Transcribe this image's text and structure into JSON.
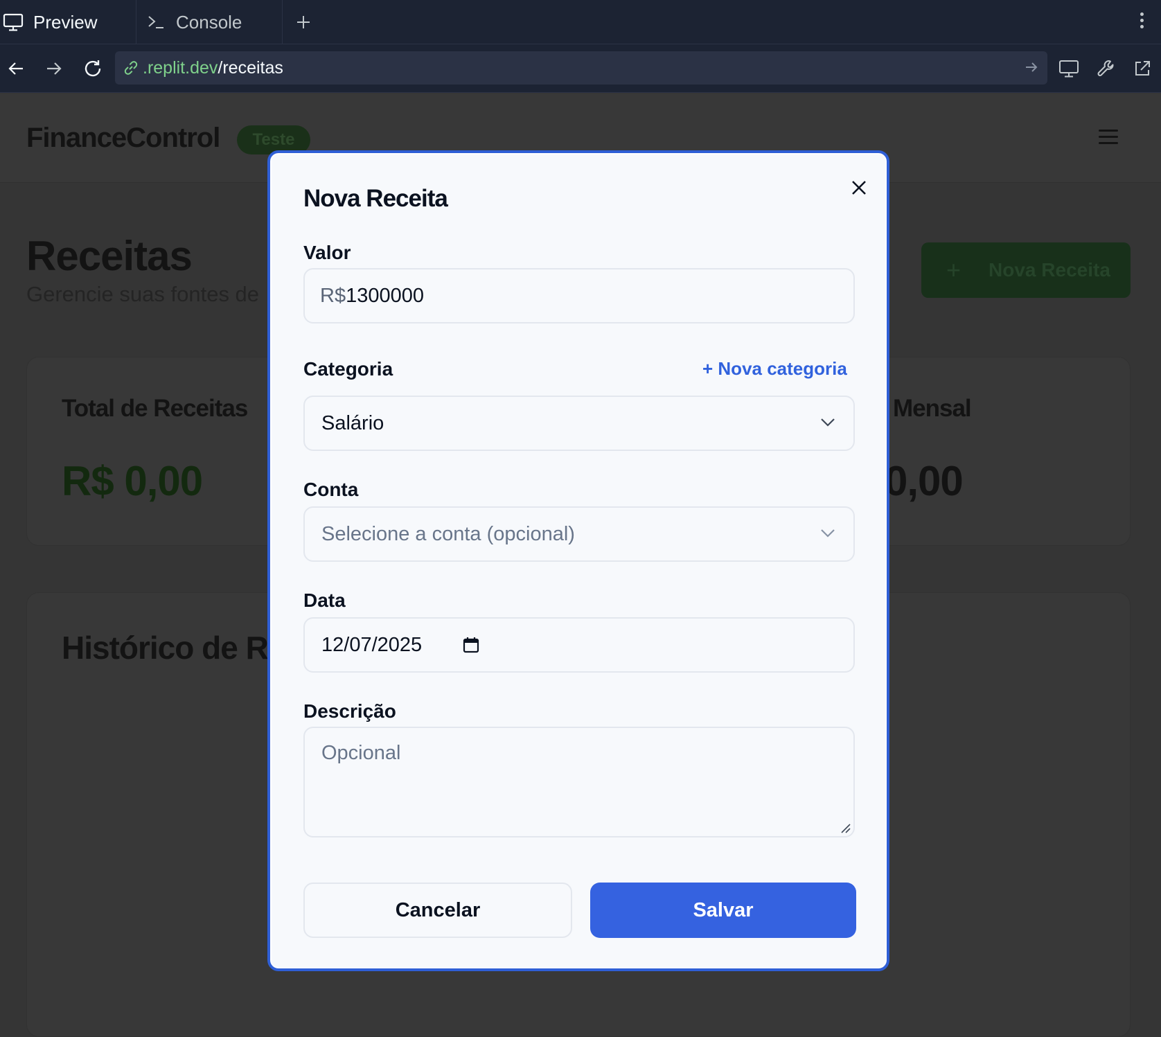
{
  "browser": {
    "tabs": [
      {
        "label": "Preview",
        "icon": "monitor-icon"
      },
      {
        "label": "Console",
        "icon": "terminal-icon"
      }
    ],
    "url_host": ".replit.dev",
    "url_path": "/receitas"
  },
  "app": {
    "brand": "FinanceControl",
    "badge": "Teste",
    "page_title": "Receitas",
    "page_subtitle": "Gerencie suas fontes de",
    "new_button": "Nova Receita",
    "card_total_label": "Total de Receitas",
    "card_total_value": "R$ 0,00",
    "card_mensal_label": "Mensal",
    "card_mensal_value": "0,00",
    "history_title": "Histórico de Re",
    "accent_green": "#1a3019"
  },
  "modal": {
    "title": "Nova Receita",
    "valor_label": "Valor",
    "valor_prefix": "R$",
    "valor_value": "1300000",
    "categoria_label": "Categoria",
    "nova_categoria": "+ Nova categoria",
    "categoria_value": "Salário",
    "conta_label": "Conta",
    "conta_placeholder": "Selecione a conta (opcional)",
    "data_label": "Data",
    "data_value": "12/07/2025",
    "descricao_label": "Descrição",
    "descricao_placeholder": "Opcional",
    "cancel": "Cancelar",
    "save": "Salvar",
    "accent_blue": "#3562e0"
  }
}
